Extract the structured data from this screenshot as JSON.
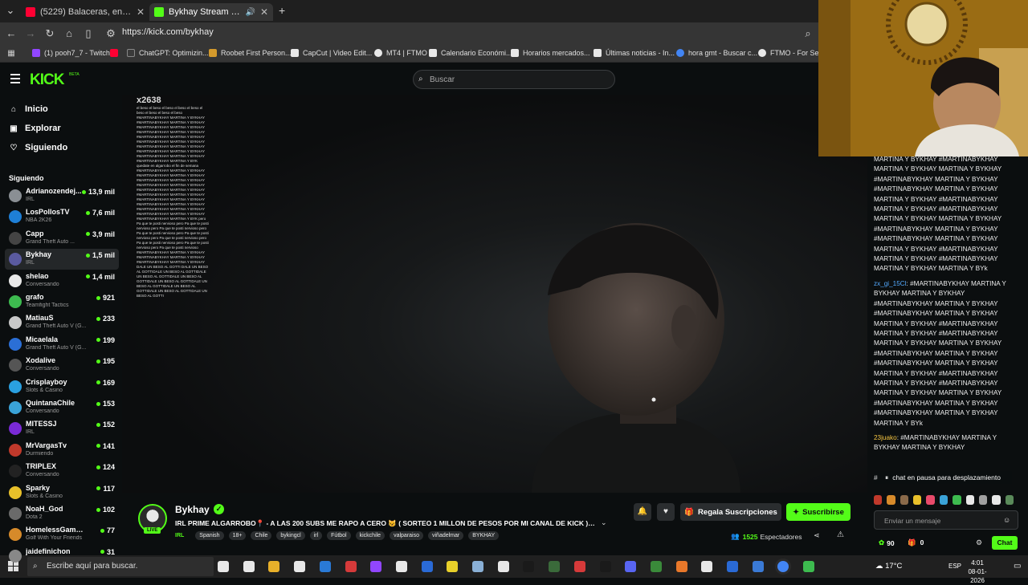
{
  "browser": {
    "tabs": [
      {
        "title": "(5229) Balaceras, encerronas y g",
        "fav_color": "#ff0033",
        "active": false
      },
      {
        "title": "Bykhay Stream - Watch Live",
        "fav_color": "#53fc18",
        "active": true
      }
    ],
    "new_tab": "+",
    "url": "https://kick.com/bykhay",
    "bookmarks": [
      {
        "label": "(1) pooh7_7 - Twitch",
        "color": "#9146ff"
      },
      {
        "label": "",
        "color": "#ff0033"
      },
      {
        "label": "ChatGPT: Optimizin...",
        "color": "#3a3a3a"
      },
      {
        "label": "Roobet First Person...",
        "color": "#d49a2c"
      },
      {
        "label": "CapCut | Video Edit...",
        "color": "#e8e8e8"
      },
      {
        "label": "MT4 | FTMO",
        "color": "#e8e8e8"
      },
      {
        "label": "Calendario Económi...",
        "color": "#e8e8e8"
      },
      {
        "label": "Horarios mercados...",
        "color": "#e8e8e8"
      },
      {
        "label": "Últimas noticias - In...",
        "color": "#e8e8e8"
      },
      {
        "label": "hora gmt - Buscar c...",
        "color": "#4285f4"
      },
      {
        "label": "FTMO - For Seriou",
        "color": "#e8e8e8"
      }
    ]
  },
  "kick": {
    "logo": "KICK",
    "logo_beta": "BETA",
    "search_placeholder": "Buscar",
    "nav": [
      {
        "label": "Inicio",
        "icon": "home-icon"
      },
      {
        "label": "Explorar",
        "icon": "compass-icon"
      },
      {
        "label": "Siguiendo",
        "icon": "heart-icon"
      }
    ],
    "following_title": "Siguiendo",
    "following": [
      {
        "name": "Adrianozendej...",
        "category": "IRL",
        "viewers": "13,9 mil",
        "color": "#8a8f94"
      },
      {
        "name": "LosPollosTV",
        "category": "NBA 2K26",
        "viewers": "7,6 mil",
        "color": "#1e7fd6"
      },
      {
        "name": "Capp",
        "category": "Grand Theft Auto ...",
        "viewers": "3,9 mil",
        "color": "#444"
      },
      {
        "name": "Bykhay",
        "category": "IRL",
        "viewers": "1,5 mil",
        "color": "#5a5aa0",
        "selected": true
      },
      {
        "name": "shelao",
        "category": "Conversando",
        "viewers": "1,4 mil",
        "color": "#e8e8e8"
      },
      {
        "name": "grafo",
        "category": "Teamfight Tactics",
        "viewers": "921",
        "color": "#3dbb4f"
      },
      {
        "name": "MatiauS",
        "category": "Grand Theft Auto V (G...",
        "viewers": "233",
        "color": "#c8c8c8"
      },
      {
        "name": "Micaelala",
        "category": "Grand Theft Auto V (G...",
        "viewers": "199",
        "color": "#2b6fd6"
      },
      {
        "name": "Xodalive",
        "category": "Conversando",
        "viewers": "195",
        "color": "#555"
      },
      {
        "name": "Crisplayboy",
        "category": "Slots & Casino",
        "viewers": "169",
        "color": "#2aa0e0"
      },
      {
        "name": "QuintanaChile",
        "category": "Conversando",
        "viewers": "153",
        "color": "#3aa3d8"
      },
      {
        "name": "MITESSJ",
        "category": "IRL",
        "viewers": "152",
        "color": "#7a2ad6"
      },
      {
        "name": "MrVargasTv",
        "category": "Durmiendo",
        "viewers": "141",
        "color": "#c0392b"
      },
      {
        "name": "TRIPLEX",
        "category": "Conversando",
        "viewers": "124",
        "color": "#222"
      },
      {
        "name": "Sparky",
        "category": "Slots & Casino",
        "viewers": "117",
        "color": "#e8c02a"
      },
      {
        "name": "NoaH_God",
        "category": "Dota 2",
        "viewers": "102",
        "color": "#6a6a6a"
      },
      {
        "name": "HomelessGambler69",
        "category": "Golf With Your Friends",
        "viewers": "77",
        "color": "#d68a2a"
      },
      {
        "name": "jaidefinichon",
        "category": "",
        "viewers": "31",
        "color": "#888"
      }
    ],
    "overlay_chat": {
      "count": "x2638",
      "text": "el beso el beso el beso el beso el beso el beso el beso el beso el beso #MARTINABYKHAY MARTINA Y BYKHAY #MARTINABYKHAY MARTINA Y BYKHAY #MARTINABYKHAY MARTINA Y BYKHAY #MARTINABYKHAY MARTINA Y BYKHAY #MARTINABYKHAY MARTINA Y BYKHAY #MARTINABYKHAY MARTINA Y BYKHAY #MARTINABYKHAY MARTINA Y BYKHAY #MARTINABYKHAY MARTINA Y BYKHAY #MARTINABYKHAY MARTINA Y BYKHAY #MARTINABYKHAY MARTINA Y BYK quedate en algarrobo el fin de semana #MARTINABYKHAY MARTINA Y BYKHAY #MARTINABYKHAY MARTINA Y BYKHAY #MARTINABYKHAY MARTINA Y BYKHAY #MARTINABYKHAY MARTINA Y BYKHAY #MARTINABYKHAY MARTINA Y BYKHAY #MARTINABYKHAY MARTINA Y BYKHAY #MARTINABYKHAY MARTINA Y BYKHAY #MARTINABYKHAY MARTINA Y BYKHAY #MARTINABYKHAY MARTINA Y BYKHAY #MARTINABYKHAY MARTINA Y BYKHAY #MARTINABYKHAY MARTINA Y BYK pero Pa que te posti nervioso pero Pa que te posti nervioso pero Pa que te posti nervioso pero Pa que te posti nervioso pero Pa que te posti nervioso pero Pa que te posti nervioso pero Pa que te posti nervioso pero Pa que te posti nervioso pero Pa que te posti nervioso #MARTINABYKHAY MARTINA Y BYKHAY #MARTINABYKHAY MARTINA Y BYKHAY #MARTINABYKHAY MARTINA Y BYKHAY DALE UN BESO AL GOTTI DALE UN BESO AL GOTTIDALE UN BESO AL GOTTIDALE UN BESO AL GOTTIDALE UN BESO AL GOTTIDALE UN BESO AL GOTTIDALE UN BESO AL GOTTIDALE UN BESO AL GOTTIDALE UN BESO AL GOTTIDALE UN BESO AL GOTTI"
    },
    "stream": {
      "streamer": "Bykhay",
      "live_label": "LIVE",
      "title": "IRL PRIME ALGARROBO📍 - A LAS 200 SUBS ME RAPO A CERO 😺 ( SORTEO 1 MILLON DE PESOS POR MI CANAL DE KICK ) @ti...",
      "category": "IRL",
      "tags": [
        "Spanish",
        "18+",
        "Chile",
        "bykingcl",
        "irl",
        "Fútbol",
        "kickchile",
        "valparaiso",
        "viñadelmar",
        "BYKHAY"
      ],
      "gift_label": "Regala Suscripciones",
      "subscribe_label": "Suscribirse",
      "viewers": "1525",
      "viewers_label": "Espectadores"
    },
    "chat": {
      "messages": [
        {
          "user": "",
          "text": "MARTINA Y BYKHAY #MARTINABYKHAY MARTINA Y BYKHAY MARTINA Y BYKHAY #MARTINABYKHAY MARTINA Y BYKHAY #MARTINABYKHAY MARTINA Y BYKHAY MARTINA Y BYKHAY #MARTINABYKHAY MARTINA Y BYKHAY #MARTINABYKHAY MARTINA Y BYKHAY MARTINA Y BYKHAY #MARTINABYKHAY MARTINA Y BYKHAY #MARTINABYKHAY MARTINA Y BYKHAY MARTINA Y BYKHAY #MARTINABYKHAY MARTINA Y BYKHAY #MARTINABYKHAY MARTINA Y BYKHAY MARTINA Y BYk"
        },
        {
          "user": "zx_gi_15Cl",
          "user_color": "u1",
          "text": ": #MARTINABYKHAY MARTINA Y BYKHAY MARTINA Y BYKHAY #MARTINABYKHAY MARTINA Y BYKHAY #MARTINABYKHAY MARTINA Y BYKHAY MARTINA Y BYKHAY #MARTINABYKHAY MARTINA Y BYKHAY #MARTINABYKHAY MARTINA Y BYKHAY MARTINA Y BYKHAY #MARTINABYKHAY MARTINA Y BYKHAY #MARTINABYKHAY MARTINA Y BYKHAY MARTINA Y BYKHAY #MARTINABYKHAY MARTINA Y BYKHAY #MARTINABYKHAY MARTINA Y BYKHAY MARTINA Y BYKHAY #MARTINABYKHAY MARTINA Y BYKHAY #MARTINABYKHAY MARTINA Y BYKHAY MARTINA Y BYk"
        },
        {
          "user": "23juako",
          "user_color": "u2",
          "text": ": #MARTINABYKHAY MARTINA Y BYKHAY MARTINA Y BYKHAY"
        }
      ],
      "pause_hash": "#",
      "pause_text": "chat en pausa para desplazamiento",
      "input_placeholder": "Enviar un mensaje",
      "points": "90",
      "kicks": "0",
      "chat_button": "Chat",
      "emote_colors": [
        "#c0392b",
        "#d68a2a",
        "#8a6a4a",
        "#e8c02a",
        "#e84a6a",
        "#3aa3d8",
        "#3dbb4f",
        "#e8e8e8",
        "#a0a0a0",
        "#e8e8e8",
        "#5a8a5a"
      ]
    }
  },
  "taskbar": {
    "search_placeholder": "Escribe aquí para buscar.",
    "apps": [
      "#e8e8e8",
      "#e8e8e8",
      "#e8b02a",
      "#e8e8e8",
      "#2a7ad6",
      "#d63a3a",
      "#9146ff",
      "#e8e8e8",
      "#2a6ad6",
      "#e8d02a",
      "#8ab0d6",
      "#e8e8e8",
      "#1a1a1a",
      "#3a6a3a",
      "#d63a3a",
      "#1a1a1a",
      "#5865f2",
      "#3a8a3a",
      "#e8782a",
      "#e8e8e8",
      "#2a6ad6",
      "#3a7ad6",
      "#4285f4",
      "#3dbb4f"
    ],
    "weather": "17°C",
    "lang": "ESP",
    "time": "4:01",
    "date": "08-01-2026"
  }
}
